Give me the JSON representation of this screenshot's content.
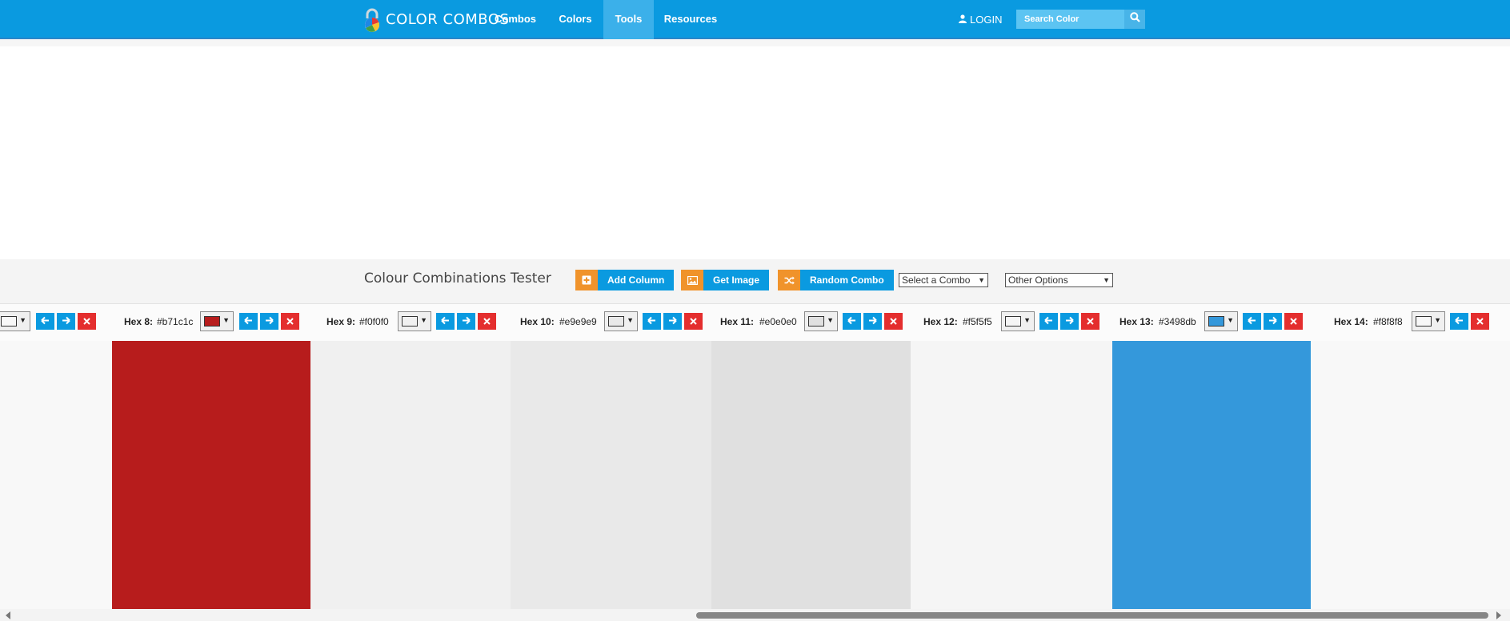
{
  "nav": {
    "logo_text": "COLOR COMBOS",
    "items": [
      {
        "label": "Combos"
      },
      {
        "label": "Colors"
      },
      {
        "label": "Tools",
        "active": true
      },
      {
        "label": "Resources"
      }
    ],
    "login_label": "LOGIN",
    "search_placeholder": "Search Color",
    "accent_color": "#0a9ae0"
  },
  "tester": {
    "title": "Colour Combinations Tester",
    "buttons": {
      "add_column": "Add Column",
      "get_image": "Get Image",
      "random_combo": "Random Combo"
    },
    "selects": {
      "combo": "Select a Combo",
      "options": "Other Options"
    }
  },
  "columns": [
    {
      "label": "",
      "hex": "",
      "color": "#f8f8f8"
    },
    {
      "label": "Hex 8:",
      "hex": "#b71c1c",
      "color": "#b71c1c"
    },
    {
      "label": "Hex 9:",
      "hex": "#f0f0f0",
      "color": "#f0f0f0"
    },
    {
      "label": "Hex 10:",
      "hex": "#e9e9e9",
      "color": "#e9e9e9"
    },
    {
      "label": "Hex 11:",
      "hex": "#e0e0e0",
      "color": "#e0e0e0"
    },
    {
      "label": "Hex 12:",
      "hex": "#f5f5f5",
      "color": "#f5f5f5"
    },
    {
      "label": "Hex 13:",
      "hex": "#3498db",
      "color": "#3498db"
    },
    {
      "label": "Hex 14:",
      "hex": "#f8f8f8",
      "color": "#f8f8f8"
    }
  ],
  "icons": {
    "logo": "lock-icon",
    "login": "user-icon",
    "search": "search-icon",
    "add": "plus-square-icon",
    "image": "image-icon",
    "random": "shuffle-icon",
    "move_left": "arrow-left-icon",
    "move_right": "arrow-right-icon",
    "remove": "close-icon"
  },
  "colors": {
    "button_blue": "#0a9ae0",
    "button_orange": "#f0932b",
    "remove_red": "#e42e2e"
  }
}
